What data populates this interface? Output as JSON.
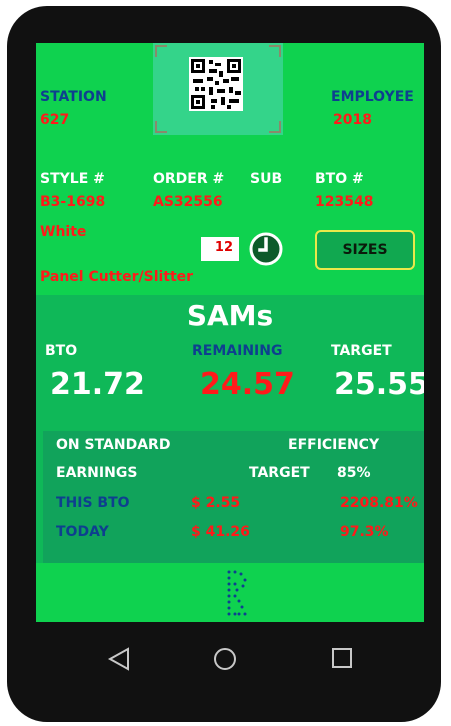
{
  "station": {
    "label": "STATION",
    "value": "627"
  },
  "employee": {
    "label": "EMPLOYEE",
    "value": "2018"
  },
  "style": {
    "label": "STYLE #",
    "value": "B3-1698",
    "color": "White"
  },
  "order": {
    "label": "ORDER #",
    "value": "AS32556"
  },
  "sub": {
    "label": "SUB"
  },
  "bto": {
    "label": "BTO #",
    "value": "123548"
  },
  "operation": "Panel Cutter/Slitter",
  "quantity": "12",
  "sizes_button": "SIZES",
  "sams": {
    "title": "SAMs",
    "bto_label": "BTO",
    "bto_value": "21.72",
    "remaining_label": "REMAINING",
    "remaining_value": "24.57",
    "target_label": "TARGET",
    "target_value": "25.55"
  },
  "earnings": {
    "on_standard": "ON STANDARD",
    "earnings": "EARNINGS",
    "efficiency": "EFFICIENCY",
    "target_label": "TARGET",
    "target_value": "85%",
    "this_bto_label": "THIS BTO",
    "this_bto_amount": "$ 2.55",
    "this_bto_pct": "2208.81%",
    "today_label": "TODAY",
    "today_amount": "$ 41.26",
    "today_pct": "97.3%"
  },
  "icons": {
    "qr": "qr-code-icon",
    "clock": "clock-icon",
    "logo": "logo-icon",
    "back": "back-icon",
    "home": "home-icon",
    "recent": "recent-apps-icon"
  },
  "colors": {
    "screen_bg": "#0fd24f",
    "label_blue": "#0e3f8f",
    "value_red": "#ff1a1a"
  }
}
